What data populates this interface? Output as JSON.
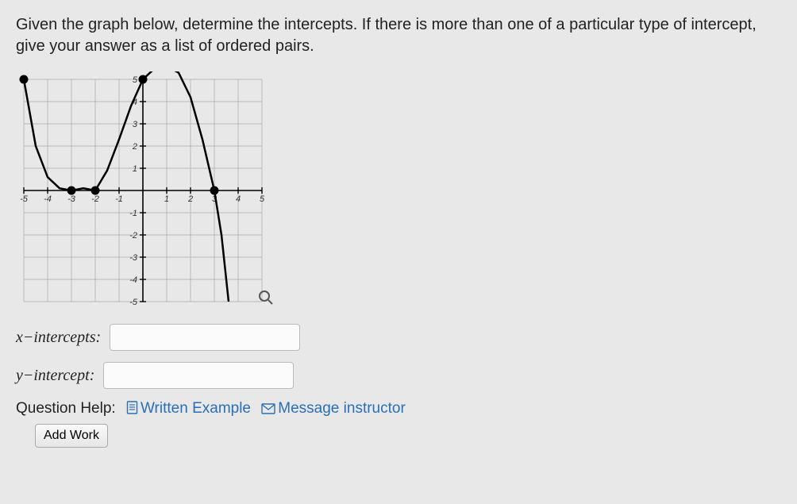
{
  "question": "Given the graph below, determine the intercepts. If there is more than one of a particular type of intercept, give your answer as a list of ordered pairs.",
  "answers": {
    "x_label": "x−intercepts: ",
    "y_label": "y−intercept: ",
    "x_value": "",
    "y_value": ""
  },
  "help": {
    "label": "Question Help:",
    "written": "Written Example",
    "message": "Message instructor",
    "add_work": "Add Work"
  },
  "chart_data": {
    "type": "line",
    "xlim": [
      -5,
      5
    ],
    "ylim": [
      -5,
      5
    ],
    "xticks": [
      -5,
      -4,
      -3,
      -2,
      -1,
      1,
      2,
      3,
      4,
      5
    ],
    "yticks": [
      -5,
      -4,
      -3,
      -2,
      -1,
      1,
      2,
      3,
      4,
      5
    ],
    "endpoints": [
      {
        "x": -5,
        "y": 5
      },
      {
        "x": 0,
        "y": 5
      }
    ],
    "x_intercepts": [
      {
        "x": -3,
        "y": 0
      },
      {
        "x": -2,
        "y": 0
      },
      {
        "x": 3,
        "y": 0
      }
    ],
    "y_intercept": {
      "x": 0,
      "y": 5
    },
    "curve_points": [
      {
        "x": -5.0,
        "y": 5.0
      },
      {
        "x": -4.5,
        "y": 2.0
      },
      {
        "x": -4.0,
        "y": 0.6
      },
      {
        "x": -3.5,
        "y": 0.1
      },
      {
        "x": -3.0,
        "y": 0.0
      },
      {
        "x": -2.75,
        "y": 0.05
      },
      {
        "x": -2.5,
        "y": 0.1
      },
      {
        "x": -2.25,
        "y": 0.05
      },
      {
        "x": -2.0,
        "y": 0.0
      },
      {
        "x": -1.5,
        "y": 0.9
      },
      {
        "x": -1.0,
        "y": 2.3
      },
      {
        "x": -0.5,
        "y": 3.8
      },
      {
        "x": 0.0,
        "y": 5.0
      },
      {
        "x": 0.5,
        "y": 5.5
      },
      {
        "x": 1.0,
        "y": 5.6
      },
      {
        "x": 1.5,
        "y": 5.3
      },
      {
        "x": 2.0,
        "y": 4.2
      },
      {
        "x": 2.5,
        "y": 2.3
      },
      {
        "x": 3.0,
        "y": 0.0
      },
      {
        "x": 3.3,
        "y": -2.0
      },
      {
        "x": 3.6,
        "y": -5.0
      }
    ]
  }
}
